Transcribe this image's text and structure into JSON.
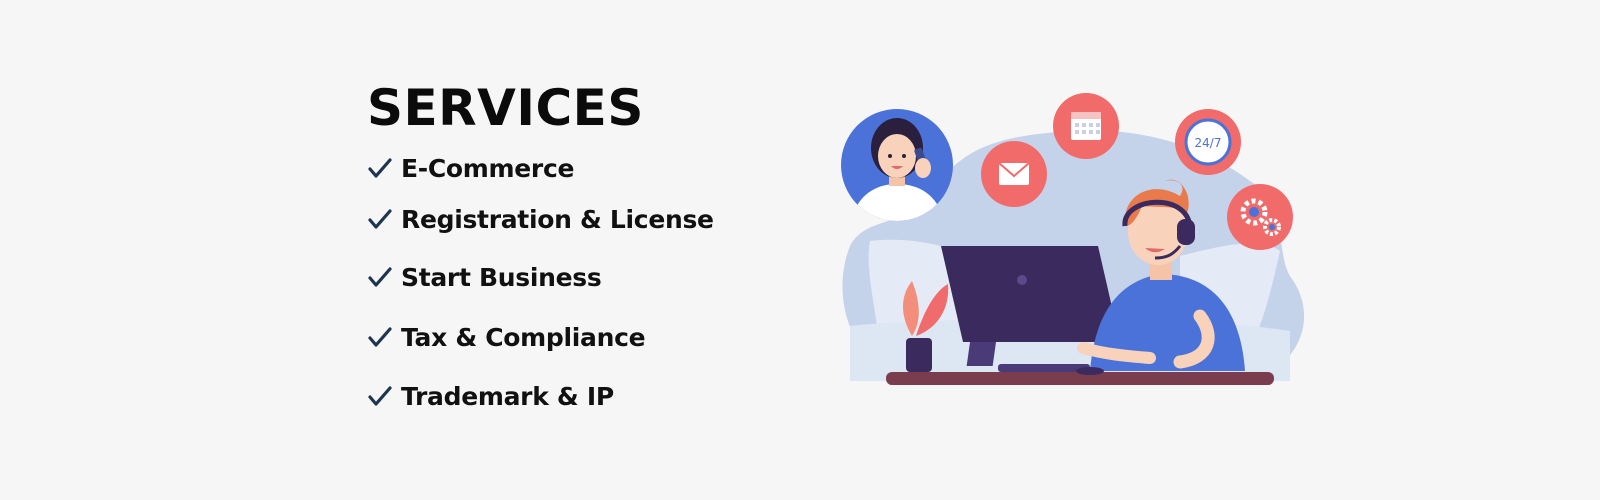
{
  "services": {
    "title": "SERVICES",
    "items": [
      {
        "label": "E-Commerce"
      },
      {
        "label": "Registration & License"
      },
      {
        "label": "Start Business"
      },
      {
        "label": "Tax & Compliance"
      },
      {
        "label": "Trademark & IP"
      }
    ]
  },
  "illustration": {
    "clock_label": "24/7"
  },
  "colors": {
    "background": "#f6f6f6",
    "text": "#111111",
    "check": "#1e3550",
    "accent_coral": "#f26b6b",
    "accent_blue": "#4a72d9",
    "monitor": "#3a2a5e",
    "blob": "#c5d3ea"
  }
}
